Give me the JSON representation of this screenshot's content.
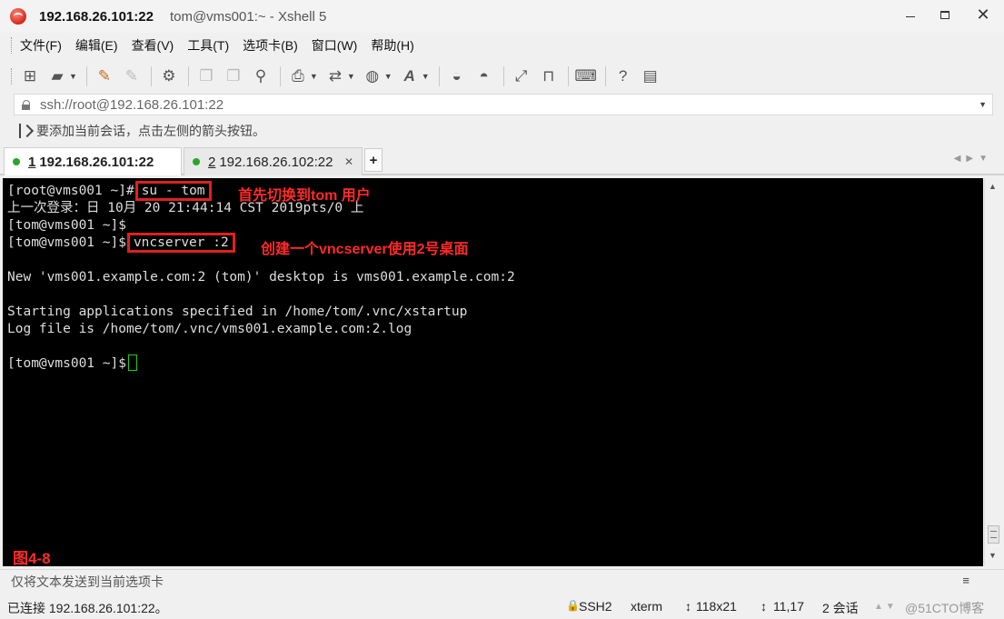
{
  "titlebar": {
    "host": "192.168.26.101:22",
    "rest": "tom@vms001:~ - Xshell 5"
  },
  "menu": [
    "文件(F)",
    "编辑(E)",
    "查看(V)",
    "工具(T)",
    "选项卡(B)",
    "窗口(W)",
    "帮助(H)"
  ],
  "address": {
    "value": "ssh://root@192.168.26.101:22"
  },
  "hint": "要添加当前会话，点击左侧的箭头按钮。",
  "tabs": [
    {
      "num": "1",
      "label": "192.168.26.101:22",
      "active": true
    },
    {
      "num": "2",
      "label": "192.168.26.102:22",
      "active": false
    }
  ],
  "terminal": {
    "lines": [
      {
        "prompt": "[root@vms001 ~]#",
        "command": "su - tom"
      },
      {
        "text": "上一次登录：日 10月 20 21:44:14 CST 2019pts/0 上"
      },
      {
        "text": "[tom@vms001 ~]$"
      },
      {
        "prompt": "[tom@vms001 ~]$",
        "command": "vncserver :2"
      },
      {
        "text": "New 'vms001.example.com:2 (tom)' desktop is vms001.example.com:2"
      },
      {
        "text": "Starting applications specified in /home/tom/.vnc/xstartup"
      },
      {
        "text": "Log file is /home/tom/.vnc/vms001.example.com:2.log"
      },
      {
        "text": "[tom@vms001 ~]$"
      }
    ],
    "annotations": [
      "首先切换到tom 用户",
      "创建一个vncserver使用2号桌面"
    ],
    "figure_label": "图4-8"
  },
  "sendbar": "仅将文本发送到当前选项卡",
  "status": {
    "connection": "已连接 192.168.26.101:22。",
    "protocol": "SSH2",
    "term": "xterm",
    "size": "118x21",
    "cursor": "11,17",
    "sessions": "2 会话",
    "watermark": "@51CTO博客"
  }
}
